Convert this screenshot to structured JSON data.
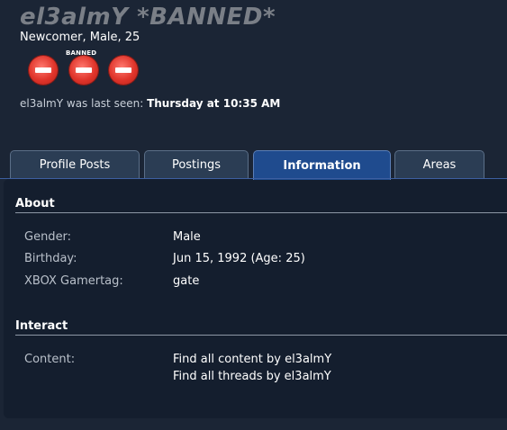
{
  "profile": {
    "username": "el3almY *BANNED*",
    "user_title": "Newcomer, Male, 25",
    "badge_label": "BANNED",
    "last_seen_prefix": "el3almY was last seen:",
    "last_seen_time": "Thursday at 10:35 AM",
    "badge_icons": [
      "banned-icon",
      "banned-icon",
      "banned-icon"
    ],
    "badge_color": "#e0352b"
  },
  "tabs": [
    {
      "label": "Profile Posts",
      "active": false
    },
    {
      "label": "Postings",
      "active": false
    },
    {
      "label": "Information",
      "active": true
    },
    {
      "label": "Areas",
      "active": false
    }
  ],
  "about": {
    "heading": "About",
    "rows": [
      {
        "label": "Gender:",
        "value": "Male"
      },
      {
        "label": "Birthday:",
        "value": "Jun 15, 1992 (Age: 25)"
      },
      {
        "label": "XBOX Gamertag:",
        "value": "gate"
      }
    ]
  },
  "interact": {
    "heading": "Interact",
    "content_label": "Content:",
    "links": [
      "Find all content by el3almY",
      "Find all threads by el3almY"
    ]
  },
  "colors": {
    "background": "#1b2535",
    "panel": "#141e2e",
    "tab": "#2b3d54",
    "tab_active": "#1f4b8e"
  }
}
